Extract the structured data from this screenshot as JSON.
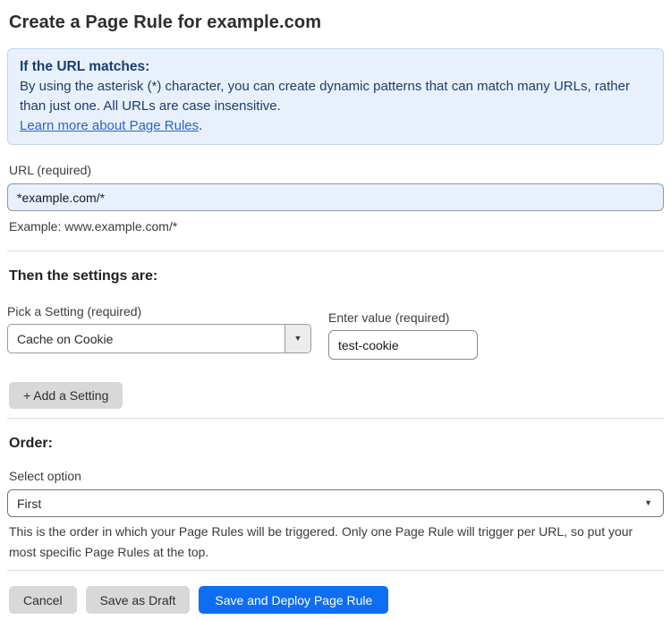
{
  "page": {
    "title": "Create a Page Rule for example.com"
  },
  "info_box": {
    "heading": "If the URL matches:",
    "body": "By using the asterisk (*) character, you can create dynamic patterns that can match many URLs, rather than just one. All URLs are case insensitive.",
    "link_label": "Learn more about Page Rules",
    "link_suffix": "."
  },
  "url_section": {
    "label": "URL (required)",
    "value": "*example.com/*",
    "helper": "Example: www.example.com/*"
  },
  "settings_section": {
    "heading": "Then the settings are:",
    "setting_label": "Pick a Setting (required)",
    "setting_value": "Cache on Cookie",
    "value_label": "Enter value (required)",
    "value_value": "test-cookie",
    "add_button_label": "+ Add a Setting"
  },
  "order_section": {
    "heading": "Order:",
    "select_label": "Select option",
    "select_value": "First",
    "helper": "This is the order in which your Page Rules will be triggered. Only one Page Rule will trigger per URL, so put your most specific Page Rules at the top."
  },
  "footer": {
    "cancel_label": "Cancel",
    "save_draft_label": "Save as Draft",
    "save_deploy_label": "Save and Deploy Page Rule"
  },
  "icons": {
    "dropdown_arrow": "▼"
  },
  "colors": {
    "primary_blue": "#0d6ef4",
    "info_bg": "#e8f1fb",
    "info_border": "#bcd4ee",
    "info_text": "#1e3c6e",
    "link_blue": "#2d64c8",
    "autofill_input_bg": "#e8f0fe",
    "gray_button_bg": "#d8d8d8"
  }
}
